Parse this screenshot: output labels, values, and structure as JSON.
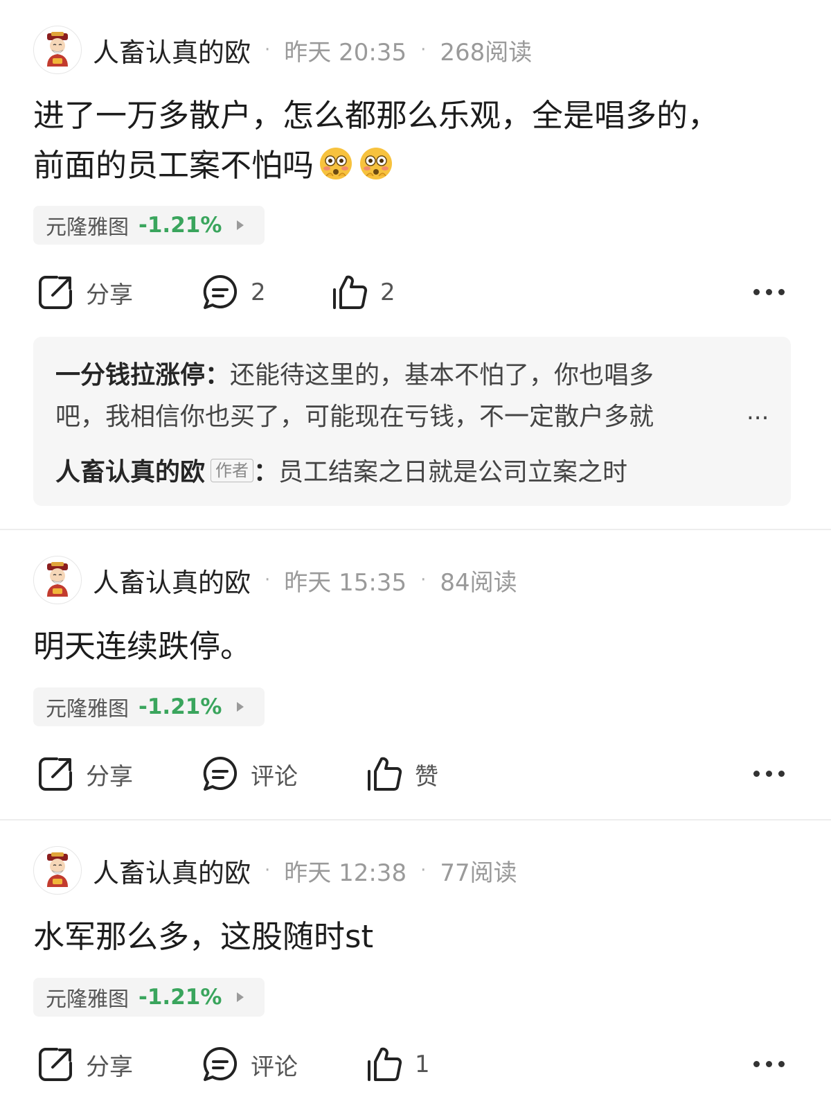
{
  "posts": [
    {
      "username": "人畜认真的欧",
      "time": "昨天 20:35",
      "reads": "268阅读",
      "content_line1": "进了一万多散户，怎么都那么乐观，全是唱多的，",
      "content_line2": "前面的员工案不怕吗",
      "stock_name": "元隆雅图",
      "stock_change": "-1.21%",
      "share_label": "分享",
      "comment_label": "2",
      "like_label": "2",
      "replies": [
        {
          "user": "一分钱拉涨停",
          "colon": "：",
          "line1": "还能待这里的，基本不怕了，你也唱多",
          "line2": "吧，我相信你也买了，可能现在亏钱，不一定散户多就",
          "ellipsis": "..."
        },
        {
          "user": "人畜认真的欧",
          "badge": "作者",
          "colon": "：",
          "line1": "员工结案之日就是公司立案之时"
        }
      ]
    },
    {
      "username": "人畜认真的欧",
      "time": "昨天 15:35",
      "reads": "84阅读",
      "content_line1": "明天连续跌停。",
      "stock_name": "元隆雅图",
      "stock_change": "-1.21%",
      "share_label": "分享",
      "comment_label": "评论",
      "like_label": "赞"
    },
    {
      "username": "人畜认真的欧",
      "time": "昨天 12:38",
      "reads": "77阅读",
      "content_line1": "水军那么多，这股随时st",
      "stock_name": "元隆雅图",
      "stock_change": "-1.21%",
      "share_label": "分享",
      "comment_label": "评论",
      "like_label": "1"
    }
  ],
  "separator": "·",
  "colors": {
    "negative_change": "#3aa55d",
    "text_secondary": "#9a9a9a"
  },
  "icons": [
    "avatar-caishen-icon",
    "share-icon",
    "comment-icon",
    "like-icon",
    "more-icon",
    "flushed-emoji-icon"
  ]
}
